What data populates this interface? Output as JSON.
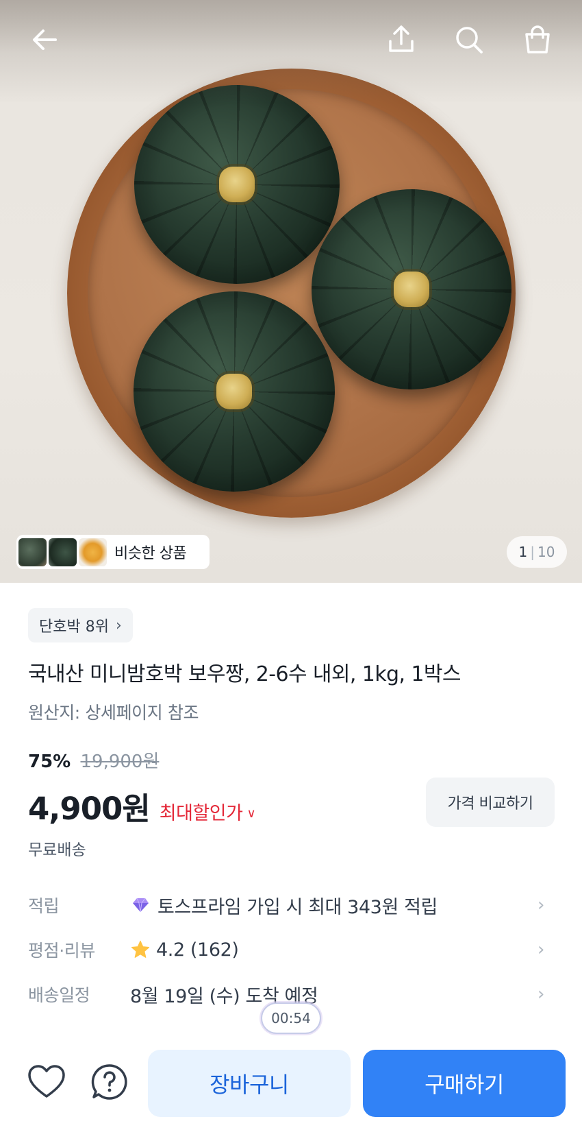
{
  "hero": {
    "similar_label": "비슷한 상품",
    "page_current": "1",
    "page_total": "10",
    "icons": [
      "back-arrow-icon",
      "share-icon",
      "search-icon",
      "shopping-bag-icon"
    ]
  },
  "product": {
    "rank_badge": "단호박 8위",
    "title": "국내산 미니밤호박 보우짱, 2-6수 내외, 1kg, 1박스",
    "origin": "원산지: 상세페이지 참조",
    "discount_rate": "75%",
    "original_price": "19,900원",
    "price": "4,900원",
    "max_discount_label": "최대할인가",
    "compare_button": "가격 비교하기",
    "shipping": "무료배송"
  },
  "info_rows": [
    {
      "label": "적립",
      "value": "토스프라임 가입 시 최대 343원 적립",
      "icon": "gem-icon"
    },
    {
      "label": "평점·리뷰",
      "value": "4.2 (162)",
      "icon": "star-icon"
    },
    {
      "label": "배송일정",
      "value": "8월 19일 (수) 도착 예정",
      "icon": ""
    }
  ],
  "timer": "00:54",
  "bottom_bar": {
    "cart_label": "장바구니",
    "buy_label": "구매하기"
  },
  "colors": {
    "accent_blue": "#3182f6",
    "cart_bg": "#e8f3ff",
    "discount_red": "#e42939",
    "star_yellow": "#ffc342"
  }
}
